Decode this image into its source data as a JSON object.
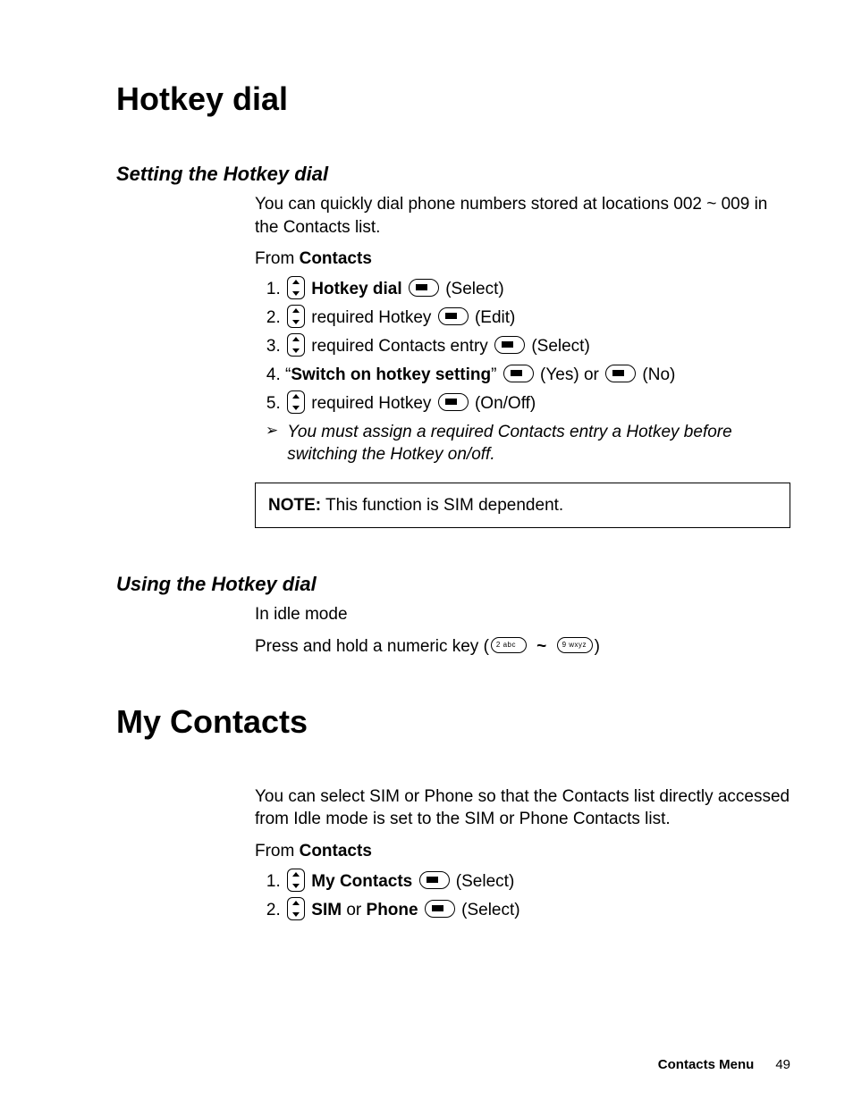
{
  "h1_hotkey": "Hotkey dial",
  "setting": {
    "title": "Setting the Hotkey dial",
    "intro": "You can quickly dial phone numbers stored at locations 002 ~ 009 in the Contacts list.",
    "from_prefix": "From ",
    "from_bold": "Contacts",
    "steps": {
      "s1_bold": "Hotkey dial",
      "s1_action": " (Select)",
      "s2_text": " required Hotkey ",
      "s2_action": " (Edit)",
      "s3_text": " required Contacts entry ",
      "s3_action": " (Select)",
      "s4_quote_open": "“",
      "s4_bold": "Switch on hotkey setting",
      "s4_quote_close": "” ",
      "s4_yes": " (Yes) or ",
      "s4_no": " (No)",
      "s5_text": " required Hotkey ",
      "s5_action": " (On/Off)"
    },
    "tip": "You must assign a required Contacts entry a Hotkey before switching the Hotkey on/off.",
    "note_label": "NOTE:",
    "note_text": " This function is SIM dependent."
  },
  "using": {
    "title": "Using the Hotkey dial",
    "line1": "In idle mode",
    "line2_pre": "Press and hold a numeric key (",
    "key2_label": "2  abc",
    "tilde": " ~ ",
    "key9_label": "9 wxyz",
    "line2_post": ")"
  },
  "h1_mycontacts": "My Contacts",
  "mycontacts": {
    "intro": "You can select SIM or Phone so that the Contacts list directly accessed from Idle mode is set to the SIM or Phone Contacts list.",
    "from_prefix": "From ",
    "from_bold": "Contacts",
    "s1_bold": "My Contacts",
    "s1_action": " (Select)",
    "s2_bold1": "SIM",
    "s2_or": " or ",
    "s2_bold2": "Phone",
    "s2_action": " (Select)"
  },
  "footer": {
    "label": "Contacts Menu",
    "page": "49"
  }
}
